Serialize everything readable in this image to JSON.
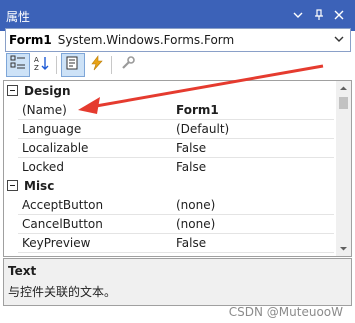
{
  "window": {
    "title": "属性"
  },
  "object_selector": {
    "name": "Form1",
    "type": "System.Windows.Forms.Form"
  },
  "toolbar": {
    "buttons": [
      {
        "icon": "categorized-icon",
        "active": true
      },
      {
        "icon": "alphabetical-icon",
        "active": false
      },
      {
        "icon": "properties-icon",
        "active": true
      },
      {
        "icon": "events-lightning-icon",
        "active": false
      },
      {
        "icon": "property-pages-wrench-icon",
        "active": false
      }
    ]
  },
  "grid": {
    "categories": [
      {
        "label": "Design",
        "properties": [
          {
            "name": "(Name)",
            "value": "Form1",
            "bold": true
          },
          {
            "name": "Language",
            "value": "(Default)"
          },
          {
            "name": "Localizable",
            "value": "False"
          },
          {
            "name": "Locked",
            "value": "False"
          }
        ]
      },
      {
        "label": "Misc",
        "properties": [
          {
            "name": "AcceptButton",
            "value": "(none)"
          },
          {
            "name": "CancelButton",
            "value": "(none)"
          },
          {
            "name": "KeyPreview",
            "value": "False"
          }
        ]
      }
    ]
  },
  "description": {
    "title": "Text",
    "text": "与控件关联的文本。"
  },
  "watermark": "CSDN @MuteuooW",
  "colors": {
    "titlebar": "#3c62b8",
    "annotation_arrow": "#e53b2f"
  }
}
